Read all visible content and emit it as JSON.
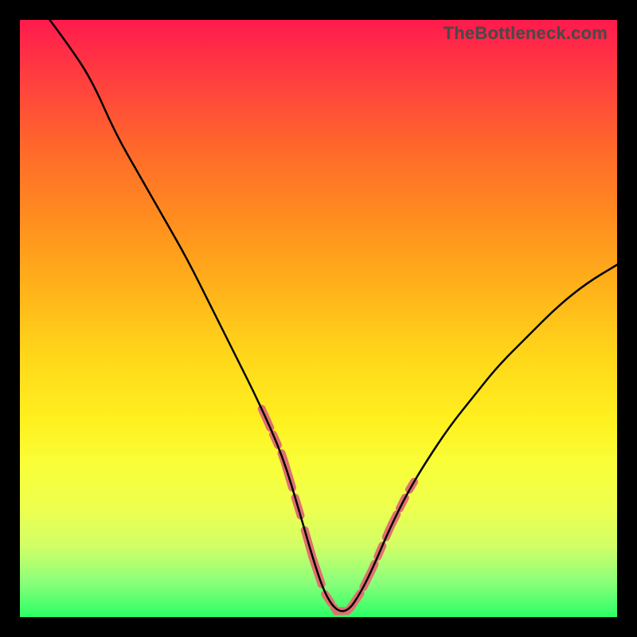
{
  "watermark": "TheBottleneck.com",
  "chart_data": {
    "type": "line",
    "title": "",
    "xlabel": "",
    "ylabel": "",
    "xlim": [
      0,
      100
    ],
    "ylim": [
      0,
      100
    ],
    "series": [
      {
        "name": "curve",
        "x": [
          5,
          8,
          12,
          16,
          20,
          24,
          28,
          32,
          36,
          40,
          44,
          47,
          49,
          51,
          53,
          55,
          57,
          59,
          62,
          65,
          68,
          72,
          76,
          80,
          85,
          90,
          95,
          100
        ],
        "y": [
          100,
          96,
          90,
          81,
          74,
          67,
          60,
          52,
          44,
          36,
          27,
          17,
          10,
          4,
          1,
          1,
          4,
          8,
          15,
          21,
          26,
          32,
          37,
          42,
          47,
          52,
          56,
          59
        ]
      }
    ],
    "highlight_zones": [
      {
        "name": "left-flank",
        "x_range": [
          40.5,
          48.5
        ]
      },
      {
        "name": "bottom",
        "x_range": [
          48.5,
          58.0
        ]
      },
      {
        "name": "right-flank",
        "x_range": [
          58.0,
          66.0
        ]
      }
    ],
    "highlight_color": "#e07070"
  }
}
